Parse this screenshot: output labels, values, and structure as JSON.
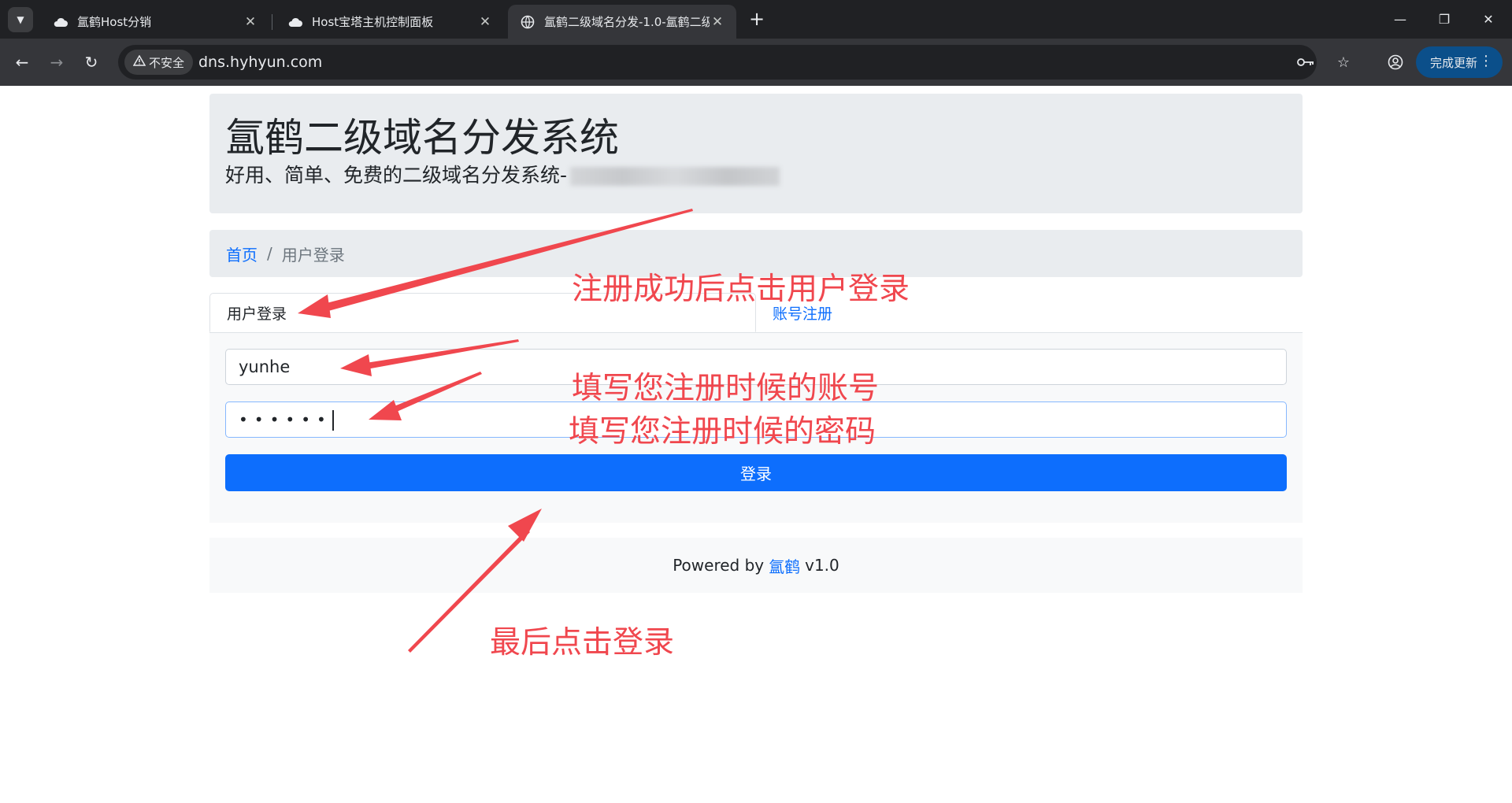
{
  "browser": {
    "tabs": [
      {
        "title": "氲鹤Host分销",
        "icon": "cloud-icon",
        "close": "✕"
      },
      {
        "title": "Host宝塔主机控制面板",
        "icon": "cloud-icon",
        "close": "✕"
      },
      {
        "title": "氲鹤二级域名分发-1.0-氲鹤二级",
        "icon": "globe-icon",
        "close": "✕",
        "active": true
      }
    ],
    "new_tab": "+",
    "security_label": "不安全",
    "url": "dns.hyhyun.com",
    "update_button": "完成更新",
    "colors": {
      "tabbar": "#202124",
      "toolbar": "#35363a",
      "update_button": "#0b4f8a"
    }
  },
  "header": {
    "title": "氲鹤二级域名分发系统",
    "subtitle": "好用、简单、免费的二级域名分发系统-"
  },
  "breadcrumb": {
    "home": "首页",
    "separator": "/",
    "current": "用户登录"
  },
  "tabs": {
    "login": "用户登录",
    "register": "账号注册"
  },
  "form": {
    "username_value": "yunhe",
    "password_mask": "••••••",
    "submit_label": "登录"
  },
  "footer": {
    "prefix": "Powered by",
    "brand": "氲鹤",
    "version": "v1.0"
  },
  "annotations": {
    "tab_hint": "注册成功后点击用户登录",
    "username_hint": "填写您注册时候的账号",
    "password_hint": "填写您注册时候的密码",
    "submit_hint": "最后点击登录"
  },
  "colors": {
    "primary": "#0d6efd",
    "annotation": "#f0474e",
    "panel": "#e9ecef"
  }
}
